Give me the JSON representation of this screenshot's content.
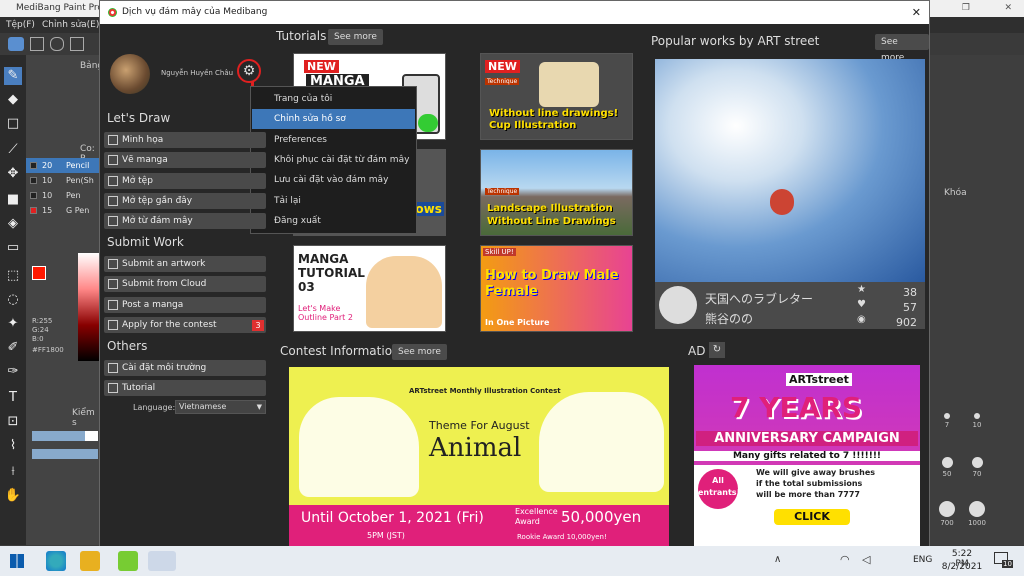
{
  "app": {
    "title": "MediBang Paint Pro",
    "menu": [
      "Tệp(F)",
      "Chỉnh sửa(E)"
    ],
    "brush_panel_title": "Bảng",
    "color_panel_title": "Co: P",
    "brushes": [
      {
        "size": "20",
        "name": "Pencil"
      },
      {
        "size": "10",
        "name": "Pen(Sh"
      },
      {
        "size": "10",
        "name": "Pen"
      },
      {
        "size": "15",
        "name": "G Pen"
      }
    ],
    "rgb": [
      "R:255",
      "G:24",
      "B:0"
    ],
    "hex": "#FF1800",
    "kiem_label": "Kiểm s",
    "khoa_label": "Khóa",
    "brush_sizes": [
      "7",
      "10",
      "50",
      "70",
      "700",
      "1000"
    ]
  },
  "dialog": {
    "title": "Dịch vụ đám mây của Medibang",
    "close": "✕"
  },
  "user": {
    "name": "Nguyễn Huyền Châu"
  },
  "lets_draw": {
    "title": "Let's Draw",
    "items": [
      "Minh họa",
      "Vẽ manga",
      "Mở tệp",
      "Mở tệp gần đây",
      "Mở từ đám mây"
    ]
  },
  "submit_work": {
    "title": "Submit Work",
    "items": [
      "Submit an artwork",
      "Submit from Cloud",
      "Post a manga",
      "Apply for the contest"
    ],
    "contest_badge": "3"
  },
  "others": {
    "title": "Others",
    "items": [
      "Cài đặt môi trường",
      "Tutorial"
    ],
    "language_label": "Language:",
    "language_value": "Vietnamese"
  },
  "user_menu": {
    "items": [
      "Trang của tôi",
      "Chỉnh sửa hồ sơ",
      "Preferences",
      "Khôi phục cài đặt từ đám mây",
      "Lưu cài đặt vào đám mây",
      "Tải lại",
      "Đăng xuất"
    ],
    "selected": 1
  },
  "tutorials": {
    "title": "Tutorials",
    "see_more": "See more",
    "cards": [
      {
        "tag": "NEW",
        "title": "MANGA",
        "sub": ""
      },
      {
        "tag": "NEW",
        "title": "Without line drawings! Cup Illustration",
        "sub": "Technique"
      },
      {
        "tag": "",
        "title": "tup windows",
        "sub": ""
      },
      {
        "tag": "",
        "title": "Landscape Illustration Without Line Drawings",
        "sub": "Technique"
      },
      {
        "tag": "",
        "title": "MANGA TUTORIAL 03",
        "sub": "Let's Make Outline Part 2"
      },
      {
        "tag": "Skill UP!",
        "title": "How to Draw Male Female",
        "sub": "In One Picture"
      }
    ]
  },
  "popular": {
    "title": "Popular works by ART street",
    "see_more": "See more",
    "work_title": "天国へのラブレター",
    "author": "熊谷のの",
    "stars": "38",
    "likes": "57",
    "views": "902"
  },
  "contest": {
    "title": "Contest Information",
    "see_more": "See more",
    "banner_header": "ARTstreet Monthly Illustration Contest",
    "theme": "Theme For August",
    "animal": "Animal",
    "until": "Until October 1, 2021 (Fri)",
    "time": "5PM (JST)",
    "award_label": "Excellence Award",
    "award_value": "50,000yen",
    "rookie": "Rookie Award 10,000yen!"
  },
  "ad": {
    "title": "AD",
    "brand": "ARTstreet",
    "years": "7 YEARS",
    "campaign": "ANNIVERSARY CAMPAIGN",
    "gifts": "Many gifts related to 7 !!!!!!!",
    "all_entrants": "All entrants!",
    "giveaway": "We will give away brushes if the total submissions will be more than 7777",
    "click": "CLICK"
  },
  "taskbar": {
    "lang": "ENG",
    "time": "5:22 PM",
    "date": "8/2/2021",
    "notif": "10"
  },
  "colors": {
    "accent": "#3d77b8",
    "red": "#e02020",
    "pink": "#e0207a"
  }
}
